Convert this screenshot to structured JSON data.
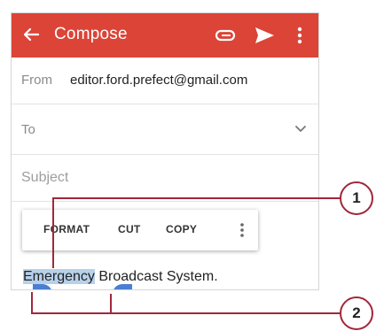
{
  "appbar": {
    "title": "Compose",
    "color": "#db4437",
    "icons": {
      "back": "back-arrow-icon",
      "attach": "attachment-icon",
      "send": "send-icon",
      "more": "more-vert-icon"
    }
  },
  "fields": {
    "from_label": "From",
    "from_value": "editor.ford.prefect@gmail.com",
    "to_label": "To",
    "to_value": "",
    "subject_placeholder": "Subject",
    "subject_value": ""
  },
  "context_menu": {
    "items": [
      "FORMAT",
      "CUT",
      "COPY"
    ],
    "more_icon": "more-vert-icon"
  },
  "body": {
    "selected_text": "Emergency",
    "rest_text": " Broadcast System.",
    "selection_color": "#b7d1ea",
    "handle_color": "#4a7fd3"
  },
  "callouts": [
    "1",
    "2"
  ],
  "callout_color": "#a1273a"
}
